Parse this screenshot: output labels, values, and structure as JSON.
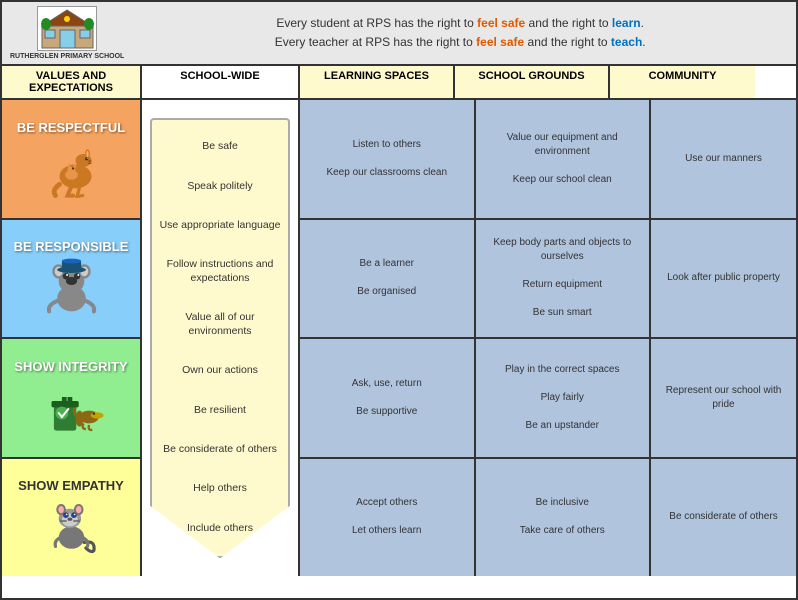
{
  "header": {
    "logo_text": "RUTHERGLEN PRIMARY SCHOOL",
    "line1_pre": "Every student at RPS has the right to ",
    "line1_mid": "feel safe",
    "line1_and": " and the right to ",
    "line1_end": "learn",
    "line1_period": ".",
    "line2_pre": "Every teacher at RPS has the right to ",
    "line2_mid": "feel safe",
    "line2_and": " and the right to ",
    "line2_end": "teach",
    "line2_period": "."
  },
  "columns": {
    "values": "VALUES AND EXPECTATIONS",
    "schoolwide": "SCHOOL-WIDE",
    "learning": "LEARNING SPACES",
    "grounds": "SCHOOL GROUNDS",
    "community": "COMMUNITY"
  },
  "values": [
    {
      "id": "respectful",
      "title": "BE RESPECTFUL",
      "color": "#f4a460"
    },
    {
      "id": "responsible",
      "title": "BE RESPONSIBLE",
      "color": "#87cefa"
    },
    {
      "id": "integrity",
      "title": "SHOW INTEGRITY",
      "color": "#90ee90"
    },
    {
      "id": "empathy",
      "title": "SHOW EMPATHY",
      "color": "#ffff99"
    }
  ],
  "schoolwide_items": [
    "Be safe",
    "Speak politely",
    "Use appropriate language",
    "Follow instructions and expectations",
    "Value all of our environments",
    "Own our actions",
    "Be resilient",
    "Be considerate of others",
    "Help others",
    "Include others"
  ],
  "learning_rows": [
    "Listen to others\n\nKeep our classrooms clean",
    "Be a learner\n\nBe organised",
    "Ask, use, return\n\nBe supportive",
    "Accept others\n\nLet others learn"
  ],
  "grounds_rows": [
    "Value our equipment and environment\n\nKeep our school clean",
    "Keep body parts and objects to ourselves\n\nReturn equipment\n\nBe sun smart",
    "Play in the correct spaces\n\nPlay fairly\n\nBe an upstander",
    "Be inclusive\n\nTake care of others"
  ],
  "community_rows": [
    "Use our manners",
    "Look after public property",
    "Represent our school with pride",
    "Be considerate of others"
  ]
}
